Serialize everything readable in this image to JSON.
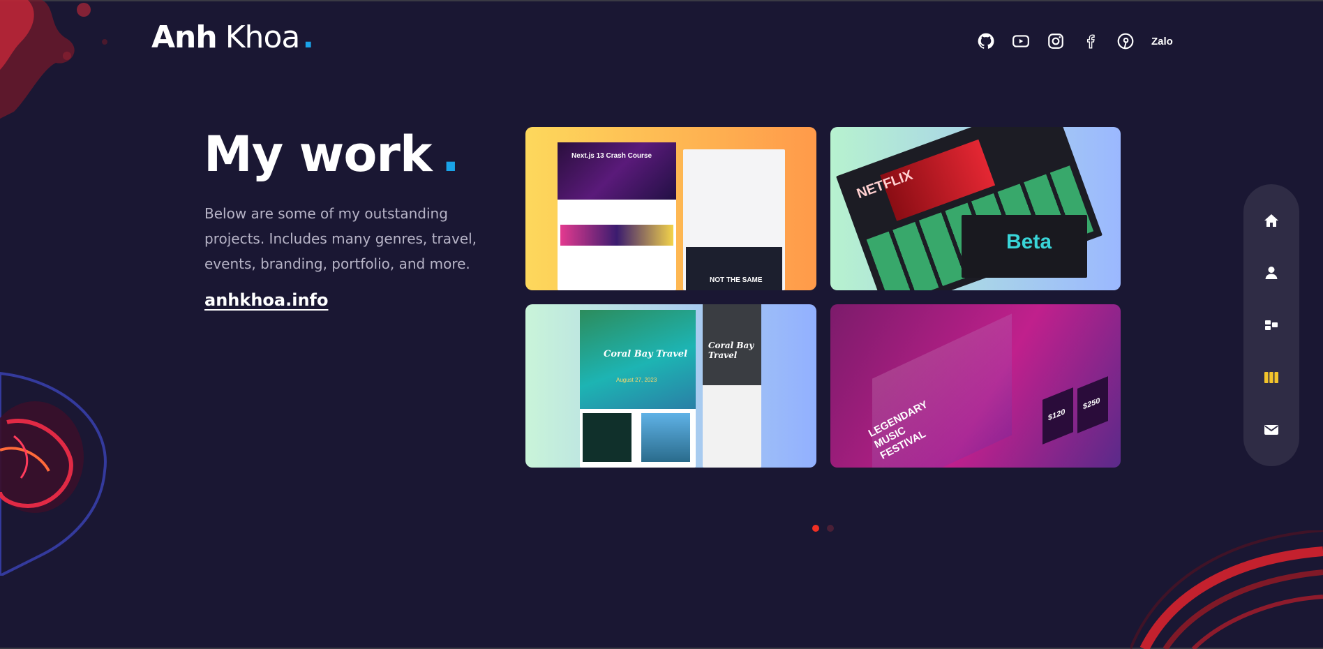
{
  "colors": {
    "background": "#1a1733",
    "accent_blue": "#1aa3e8",
    "accent_red": "#f13024",
    "accent_yellow": "#f3c42b",
    "nav_bg": "#2f2c45",
    "muted_text": "#b7b4c7"
  },
  "header": {
    "logo_first": "Anh",
    "logo_second": "Khoa",
    "logo_dot": ".",
    "socials": [
      {
        "name": "github",
        "icon": "github-icon"
      },
      {
        "name": "youtube",
        "icon": "youtube-icon"
      },
      {
        "name": "instagram",
        "icon": "instagram-icon"
      },
      {
        "name": "facebook",
        "icon": "facebook-icon"
      },
      {
        "name": "pinterest",
        "icon": "pinterest-icon"
      }
    ],
    "zalo_label": "Zalo"
  },
  "hero": {
    "title": "My work",
    "title_dot": ".",
    "description": "Below are some of my outstanding projects. Includes many genres, travel, events, branding, portfolio, and more.",
    "link_text": "anhkhoa.info"
  },
  "projects": [
    {
      "icon": "project-thumbnail",
      "screenshot_text": [
        "Next.js 13 Crash Course",
        "NOT THE SAME"
      ]
    },
    {
      "icon": "project-thumbnail",
      "screenshot_text": [
        "NETFLIX",
        "Beta"
      ]
    },
    {
      "icon": "project-thumbnail",
      "screenshot_text": [
        "Coral Bay Travel",
        "August 27, 2023"
      ]
    },
    {
      "icon": "project-thumbnail",
      "screenshot_text": [
        "LEGENDARY MUSIC FESTIVAL",
        "$120",
        "$250"
      ]
    }
  ],
  "pagination": {
    "pages": 2,
    "active": 1
  },
  "sidenav": {
    "items": [
      {
        "name": "home",
        "icon": "home-icon",
        "active": false
      },
      {
        "name": "about",
        "icon": "user-icon",
        "active": false
      },
      {
        "name": "services",
        "icon": "services-icon",
        "active": false
      },
      {
        "name": "work",
        "icon": "work-icon",
        "active": true
      },
      {
        "name": "contact",
        "icon": "mail-icon",
        "active": false
      }
    ]
  }
}
